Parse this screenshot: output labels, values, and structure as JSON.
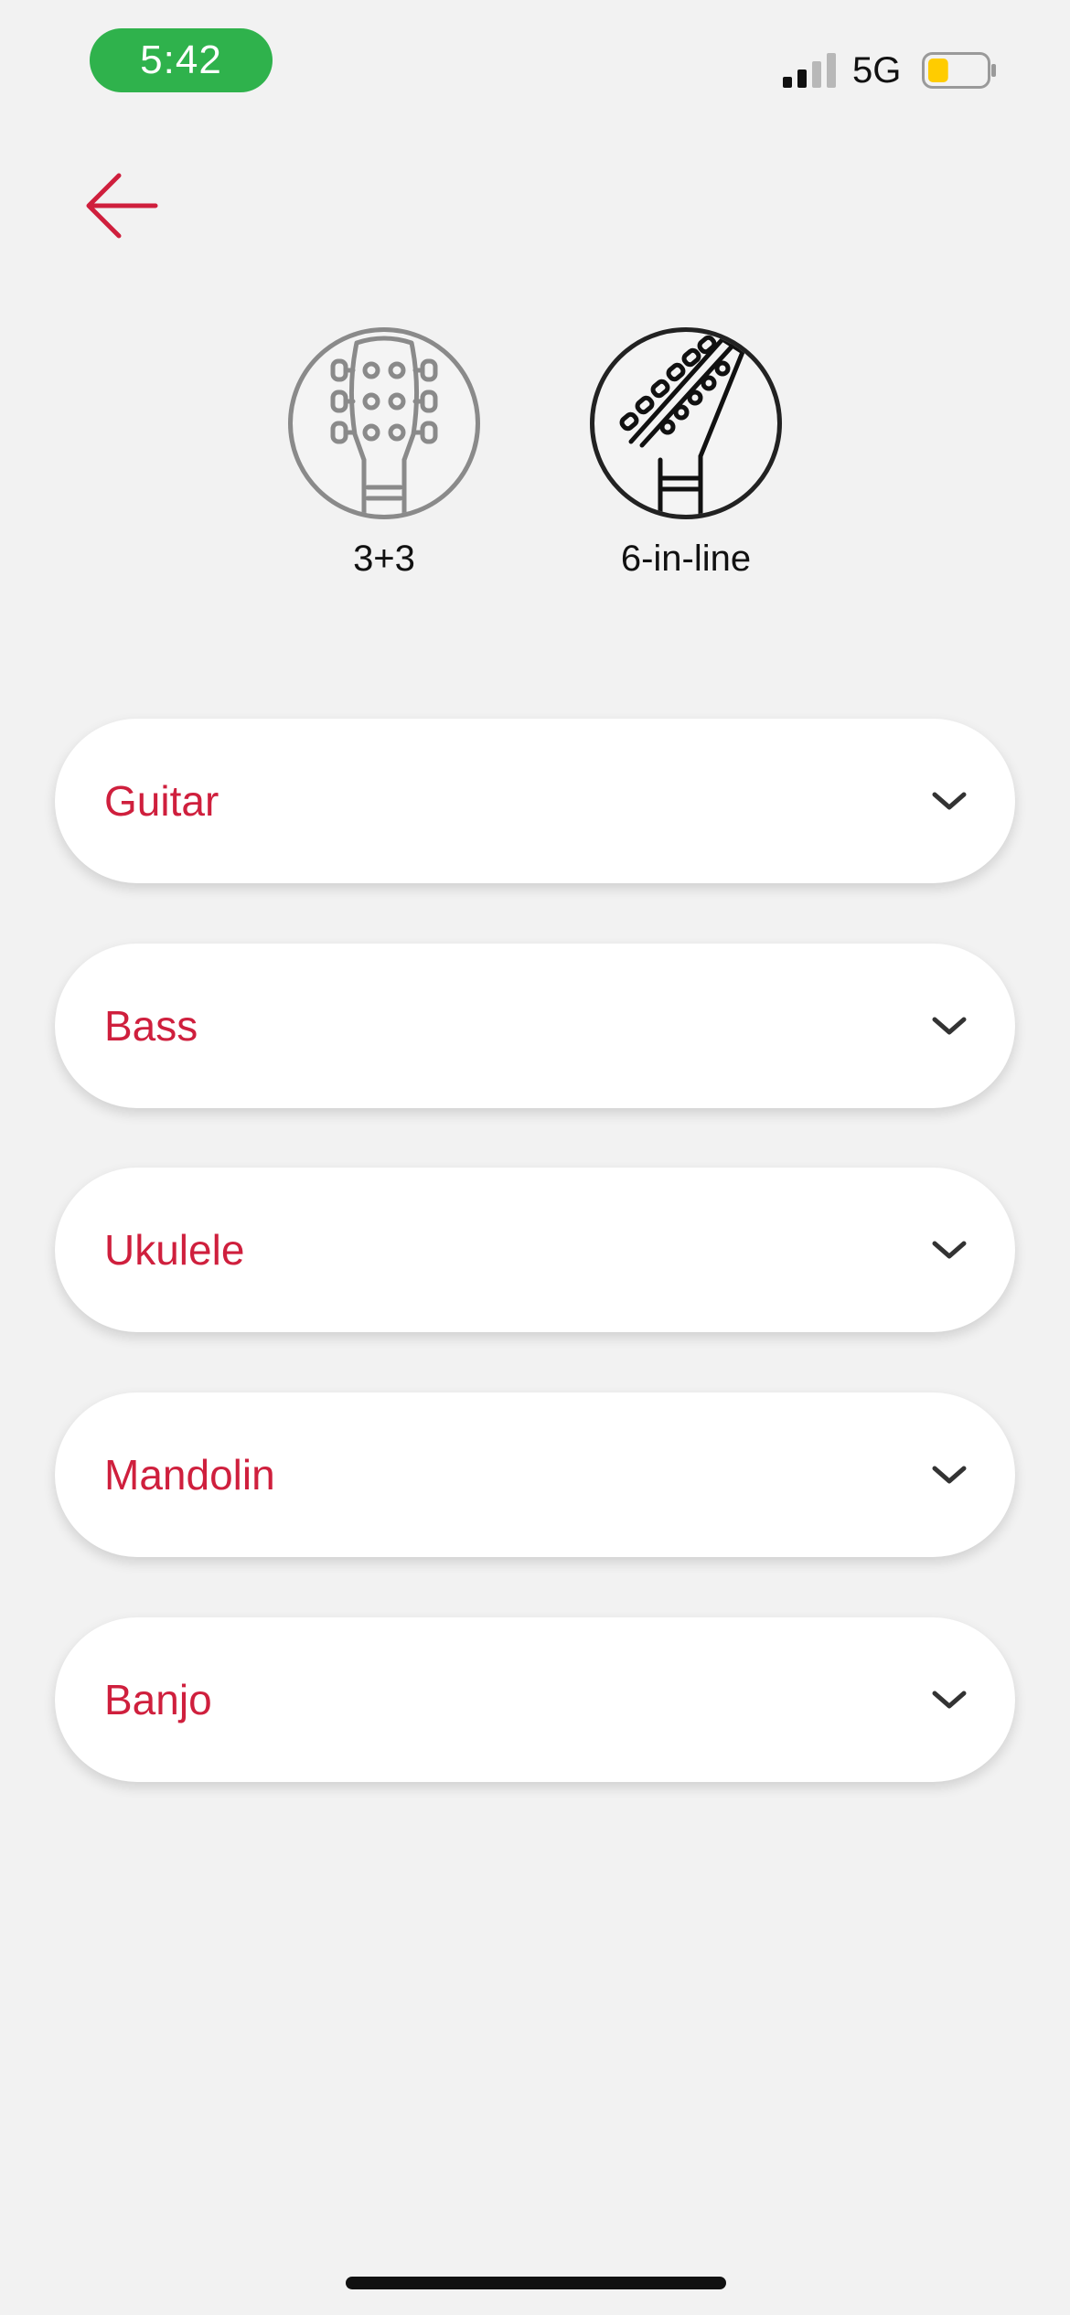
{
  "status_bar": {
    "time": "5:42",
    "network": "5G",
    "signal_bars_active": 2,
    "signal_bars_total": 4,
    "battery_level": 0.35
  },
  "colors": {
    "accent": "#cf1f3d",
    "time_pill": "#2fb24c",
    "battery_fill": "#ffcc00",
    "background": "#f2f2f2"
  },
  "headstock_options": [
    {
      "label": "3+3",
      "icon": "headstock-3-plus-3-icon",
      "selected": false
    },
    {
      "label": "6-in-line",
      "icon": "headstock-6-in-line-icon",
      "selected": true
    }
  ],
  "instruments": [
    {
      "label": "Guitar",
      "expanded": false
    },
    {
      "label": "Bass",
      "expanded": false
    },
    {
      "label": "Ukulele",
      "expanded": false
    },
    {
      "label": "Mandolin",
      "expanded": false
    },
    {
      "label": "Banjo",
      "expanded": false
    }
  ]
}
